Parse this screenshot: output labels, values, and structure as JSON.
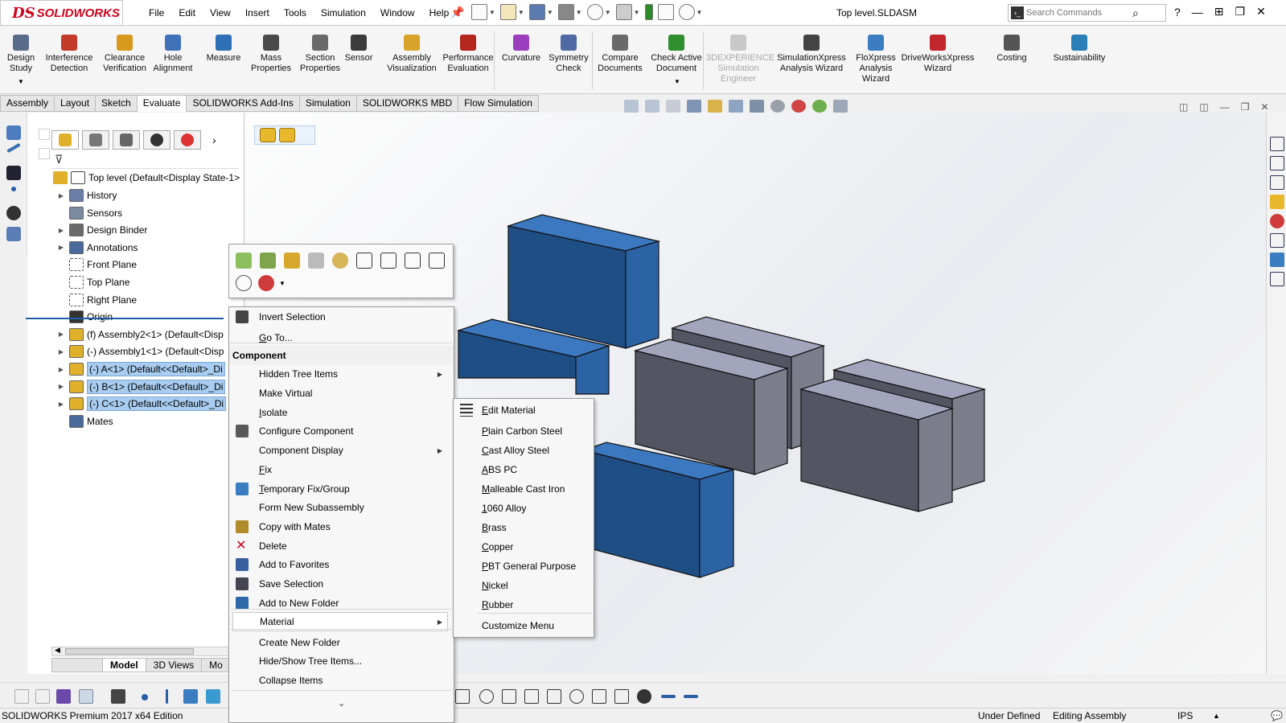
{
  "app": {
    "logo_mark": "DS",
    "logo_text": "SOLIDWORKS",
    "document_title": "Top level.SLDASM"
  },
  "menu": [
    "File",
    "Edit",
    "View",
    "Insert",
    "Tools",
    "Simulation",
    "Window",
    "Help"
  ],
  "search": {
    "placeholder": "Search Commands"
  },
  "command_manager": [
    {
      "label": "Design\nStudy",
      "icon": "design-study-icon",
      "color": "#5a6c8a"
    },
    {
      "label": "Interference\nDetection",
      "icon": "interference-icon",
      "color": "#c43a2a"
    },
    {
      "label": "Clearance\nVerification",
      "icon": "clearance-icon",
      "color": "#d79a1d"
    },
    {
      "label": "Hole\nAlignment",
      "icon": "hole-alignment-icon",
      "color": "#3f72b8"
    },
    {
      "label": "Measure",
      "icon": "measure-icon",
      "color": "#2f6fb5"
    },
    {
      "label": "Mass\nProperties",
      "icon": "mass-properties-icon",
      "color": "#4a4a4a"
    },
    {
      "label": "Section\nProperties",
      "icon": "section-properties-icon",
      "color": "#6a6a6a"
    },
    {
      "label": "Sensor",
      "icon": "sensor-icon",
      "color": "#3b3b3b"
    },
    {
      "label": "Assembly\nVisualization",
      "icon": "assembly-visualization-icon",
      "color": "#d8a32a"
    },
    {
      "label": "Performance\nEvaluation",
      "icon": "performance-icon",
      "color": "#b3271d"
    },
    {
      "label": "Curvature",
      "icon": "curvature-icon",
      "color": "#9b3fbf"
    },
    {
      "label": "Symmetry\nCheck",
      "icon": "symmetry-icon",
      "color": "#4f6aa5"
    },
    {
      "label": "Compare\nDocuments",
      "icon": "compare-icon",
      "color": "#6a6a6a"
    },
    {
      "label": "Check Active\nDocument",
      "icon": "check-document-icon",
      "color": "#2f8f2f"
    },
    {
      "label": "3DEXPERIENCE\nSimulation\nEngineer",
      "icon": "3dexperience-icon",
      "color": "#c8c8c8"
    },
    {
      "label": "SimulationXpress\nAnalysis Wizard",
      "icon": "simxpress-icon",
      "color": "#444"
    },
    {
      "label": "FloXpress\nAnalysis\nWizard",
      "icon": "floxpress-icon",
      "color": "#3a7dc0"
    },
    {
      "label": "DriveWorksXpress\nWizard",
      "icon": "driveworks-icon",
      "color": "#c1272d"
    },
    {
      "label": "Costing",
      "icon": "costing-icon",
      "color": "#555"
    },
    {
      "label": "Sustainability",
      "icon": "sustainability-icon",
      "color": "#2a7fb8"
    }
  ],
  "tabs": [
    {
      "label": "Assembly",
      "active": false
    },
    {
      "label": "Layout",
      "active": false
    },
    {
      "label": "Sketch",
      "active": false
    },
    {
      "label": "Evaluate",
      "active": true
    },
    {
      "label": "SOLIDWORKS Add-Ins",
      "active": false
    },
    {
      "label": "Simulation",
      "active": false
    },
    {
      "label": "SOLIDWORKS MBD",
      "active": false
    },
    {
      "label": "Flow Simulation",
      "active": false
    }
  ],
  "tree": {
    "root": "Top level  (Default<Display State-1>",
    "items": [
      {
        "label": "History",
        "arrow": true,
        "icon": "history-icon",
        "selected": false
      },
      {
        "label": "Sensors",
        "arrow": false,
        "icon": "sensors-icon",
        "selected": false
      },
      {
        "label": "Design Binder",
        "arrow": true,
        "icon": "design-binder-icon",
        "selected": false
      },
      {
        "label": "Annotations",
        "arrow": true,
        "icon": "annotations-icon",
        "selected": false
      },
      {
        "label": "Front Plane",
        "arrow": false,
        "icon": "plane-icon",
        "selected": false
      },
      {
        "label": "Top Plane",
        "arrow": false,
        "icon": "plane-icon",
        "selected": false
      },
      {
        "label": "Right Plane",
        "arrow": false,
        "icon": "plane-icon",
        "selected": false
      },
      {
        "label": "Origin",
        "arrow": false,
        "icon": "origin-icon",
        "selected": false
      },
      {
        "label": "(f) Assembly2<1> (Default<Disp",
        "arrow": true,
        "icon": "assembly-icon",
        "selected": false
      },
      {
        "label": "(-) Assembly1<1> (Default<Disp",
        "arrow": true,
        "icon": "assembly-icon",
        "selected": false
      },
      {
        "label": "(-) A<1> (Default<<Default>_Di",
        "arrow": true,
        "icon": "part-icon",
        "selected": true
      },
      {
        "label": "(-) B<1> (Default<<Default>_Di",
        "arrow": true,
        "icon": "part-icon",
        "selected": true
      },
      {
        "label": "(-) C<1> (Default<<Default>_Di",
        "arrow": true,
        "icon": "part-icon",
        "selected": true
      },
      {
        "label": "Mates",
        "arrow": false,
        "icon": "mates-icon",
        "selected": false
      }
    ]
  },
  "bottom_tabs": [
    "Model",
    "3D Views",
    "Mo"
  ],
  "context_menu": {
    "items": [
      {
        "label": "Invert Selection",
        "u": "",
        "icon": "invert-selection-icon",
        "type": "item"
      },
      {
        "label": "Go To...",
        "u": "G",
        "icon": "",
        "type": "item"
      },
      {
        "label": "Component",
        "type": "header"
      },
      {
        "label": "Hidden Tree Items",
        "u": "",
        "icon": "",
        "type": "sub"
      },
      {
        "label": "Make Virtual",
        "u": "",
        "icon": "",
        "type": "item"
      },
      {
        "label": "Isolate",
        "u": "I",
        "icon": "",
        "type": "item"
      },
      {
        "label": "Configure Component",
        "u": "",
        "icon": "configure-icon",
        "type": "item"
      },
      {
        "label": "Component Display",
        "u": "",
        "icon": "",
        "type": "sub"
      },
      {
        "label": "Fix",
        "u": "F",
        "icon": "",
        "type": "item"
      },
      {
        "label": "Temporary Fix/Group",
        "u": "T",
        "icon": "temporary-fix-icon",
        "type": "item"
      },
      {
        "label": "Form New Subassembly",
        "u": "",
        "icon": "",
        "type": "item"
      },
      {
        "label": "Copy with Mates",
        "u": "",
        "icon": "copy-mates-icon",
        "type": "item"
      },
      {
        "label": "Delete",
        "u": "",
        "icon": "delete-icon",
        "type": "item"
      },
      {
        "label": "Add to Favorites",
        "u": "",
        "icon": "favorites-icon",
        "type": "item"
      },
      {
        "label": "Save Selection",
        "u": "",
        "icon": "save-selection-icon",
        "type": "item"
      },
      {
        "label": "Add to New Folder",
        "u": "",
        "icon": "folder-icon",
        "type": "item"
      },
      {
        "label": "Material",
        "u": "",
        "icon": "",
        "type": "sub-active"
      },
      {
        "label": "Create New Folder",
        "u": "",
        "icon": "",
        "type": "item"
      },
      {
        "label": "Hide/Show Tree Items...",
        "u": "",
        "icon": "",
        "type": "item"
      },
      {
        "label": "Collapse Items",
        "u": "",
        "icon": "",
        "type": "item"
      }
    ],
    "more_glyph": "⌄"
  },
  "material_submenu": [
    {
      "label": "Edit Material",
      "u": "E",
      "icon": "edit-material-icon"
    },
    {
      "label": "Plain Carbon Steel",
      "u": "P",
      "icon": ""
    },
    {
      "label": "Cast Alloy Steel",
      "u": "C",
      "icon": ""
    },
    {
      "label": "ABS PC",
      "u": "A",
      "icon": ""
    },
    {
      "label": "Malleable Cast Iron",
      "u": "M",
      "icon": ""
    },
    {
      "label": "1060 Alloy",
      "u": "1",
      "icon": ""
    },
    {
      "label": "Brass",
      "u": "B",
      "icon": ""
    },
    {
      "label": "Copper",
      "u": "C",
      "icon": ""
    },
    {
      "label": "PBT General Purpose",
      "u": "P",
      "icon": ""
    },
    {
      "label": "Nickel",
      "u": "N",
      "icon": ""
    },
    {
      "label": "Rubber",
      "u": "R",
      "icon": ""
    },
    {
      "label": "Customize Menu",
      "u": "",
      "icon": ""
    }
  ],
  "status": {
    "edition": "SOLIDWORKS Premium 2017 x64 Edition",
    "state": "Under Defined",
    "mode": "Editing Assembly",
    "units": "IPS"
  },
  "colors": {
    "selected_box": "#2e68a8",
    "gray_box": "#7d7e8c",
    "accent": "#d0021b"
  }
}
